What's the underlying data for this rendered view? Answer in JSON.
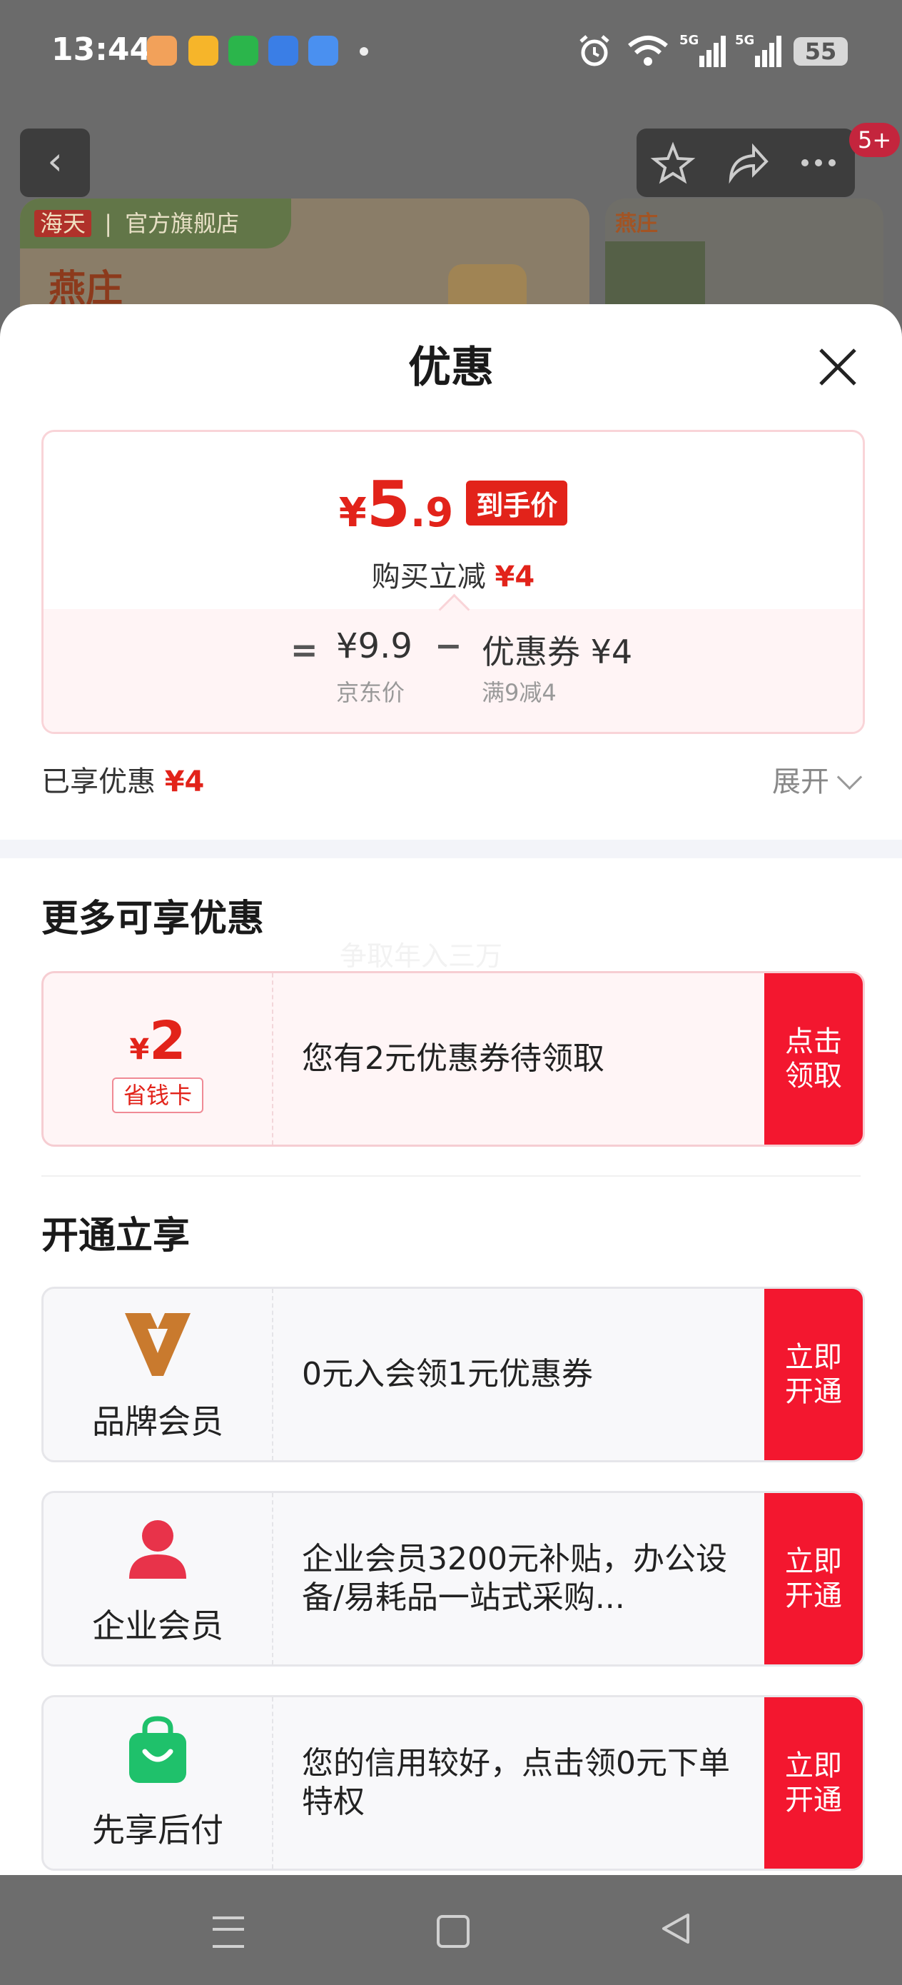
{
  "status_bar": {
    "time": "13:44",
    "signal_label": "5G",
    "battery": "55",
    "icons": [
      "alarm-icon",
      "wifi-icon",
      "signal-5g-icon",
      "signal-5g-icon",
      "battery-icon"
    ]
  },
  "background_page": {
    "badge": "5+",
    "banner_tag_brand": "海天",
    "banner_tag_text": "官方旗舰店",
    "banner_brand": "燕庄",
    "banner2_brand": "燕庄"
  },
  "sheet": {
    "title": "优惠",
    "price": {
      "yen": "¥",
      "integer": "5",
      "decimal": ".9",
      "tag": "到手价",
      "reduce_prefix": "购买立减",
      "reduce_amount": "¥4"
    },
    "breakdown": {
      "equals": "=",
      "jd_price": "¥9.9",
      "jd_label": "京东价",
      "minus": "−",
      "coupon_price": "优惠券 ¥4",
      "coupon_label": "满9减4"
    },
    "enjoyed_label": "已享优惠",
    "enjoyed_amount": "¥4",
    "expand_label": "展开",
    "more_title": "更多可享优惠",
    "watermark": "争取年入三万",
    "savings_card": {
      "yen": "¥",
      "amount": "2",
      "tag": "省钱卡",
      "text": "您有2元优惠券待领取",
      "button": "点击\n领取"
    },
    "open_title": "开通立享",
    "memberships": [
      {
        "label": "品牌会员",
        "text": "0元入会领1元优惠券",
        "button": "立即\n开通"
      },
      {
        "label": "企业会员",
        "text": "企业会员3200元补贴，办公设备/易耗品一站式采购...",
        "button": "立即\n开通"
      },
      {
        "label": "先享后付",
        "text": "您的信用较好，点击领0元下单特权",
        "button": "立即\n开通"
      }
    ]
  },
  "colors": {
    "accent_red": "#e2231a",
    "button_red": "#f3172f",
    "brand_member_gold": "#c97a2e",
    "pay_later_green": "#1fc16b"
  }
}
